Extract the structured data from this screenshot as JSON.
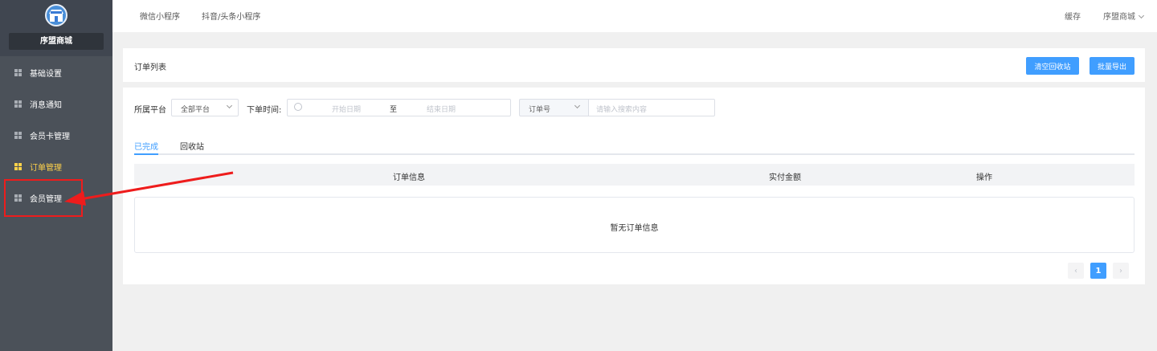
{
  "sidebar": {
    "shop_name": "序盟商城",
    "items": [
      {
        "label": "基础设置",
        "active": false
      },
      {
        "label": "消息通知",
        "active": false
      },
      {
        "label": "会员卡管理",
        "active": false
      },
      {
        "label": "订单管理",
        "active": true
      },
      {
        "label": "会员管理",
        "active": false
      }
    ]
  },
  "topbar": {
    "tabs": [
      "微信小程序",
      "抖音/头条小程序"
    ],
    "cache_label": "缓存",
    "user_label": "序盟商城"
  },
  "panel": {
    "title": "订单列表",
    "clear_button": "清空回收站",
    "export_button": "批量导出"
  },
  "filters": {
    "platform_label": "所属平台",
    "platform_value": "全部平台",
    "time_label": "下单时间:",
    "start_placeholder": "开始日期",
    "range_separator": "至",
    "end_placeholder": "结束日期",
    "search_type_value": "订单号",
    "search_placeholder": "请输入搜索内容"
  },
  "tabs": [
    {
      "label": "已完成",
      "active": true
    },
    {
      "label": "回收站",
      "active": false
    }
  ],
  "table": {
    "columns": [
      "订单信息",
      "实付金额",
      "操作"
    ],
    "empty_text": "暂无订单信息"
  },
  "pagination": {
    "prev": "‹",
    "current_page": "1",
    "next": "›"
  },
  "colors": {
    "accent": "#409eff",
    "sidebar_bg": "#4b5159",
    "active_menu": "#ffd24a",
    "annotation": "#ee1c1c"
  }
}
